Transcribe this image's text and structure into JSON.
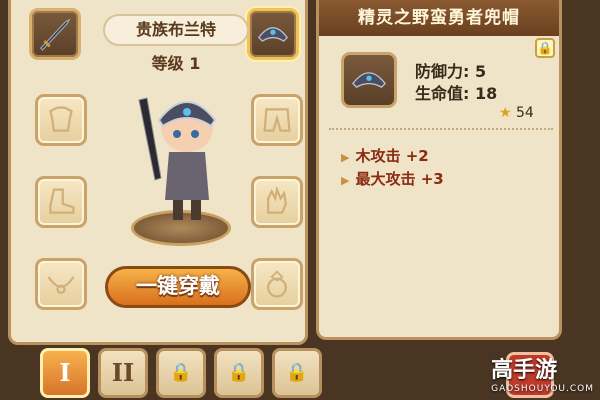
{
  "character": {
    "name": "贵族布兰特",
    "level_text": "等级 1",
    "equip_all_label": "一键穿戴"
  },
  "slots": [
    {
      "name": "weapon-slot",
      "icon": "sword-icon",
      "filled": true
    },
    {
      "name": "helmet-slot",
      "icon": "helmet-icon",
      "filled": true
    },
    {
      "name": "armor-slot",
      "icon": "armor-icon",
      "filled": false
    },
    {
      "name": "pants-slot",
      "icon": "pants-icon",
      "filled": false
    },
    {
      "name": "boots-slot",
      "icon": "boots-icon",
      "filled": false
    },
    {
      "name": "gloves-slot",
      "icon": "gloves-icon",
      "filled": false
    },
    {
      "name": "necklace-slot",
      "icon": "necklace-icon",
      "filled": false
    },
    {
      "name": "ring-slot",
      "icon": "ring-icon",
      "filled": false
    }
  ],
  "item": {
    "title": "精灵之野蛮勇者兜帽",
    "defense": "防御力: 5",
    "hp": "生命值: 18",
    "score": "54",
    "bonuses": [
      "木攻击 +2",
      "最大攻击 +3"
    ]
  },
  "tabs": [
    {
      "label": "I",
      "state": "active"
    },
    {
      "label": "II",
      "state": "normal"
    },
    {
      "label": "",
      "state": "locked"
    },
    {
      "label": "",
      "state": "locked"
    },
    {
      "label": "",
      "state": "locked"
    }
  ],
  "watermark": {
    "brand": "高手游",
    "domain": "GAOSHOUYOU.COM"
  },
  "colors": {
    "accent": "#d8701c",
    "panel": "#efe3c8",
    "title_bar": "#6a4020"
  }
}
